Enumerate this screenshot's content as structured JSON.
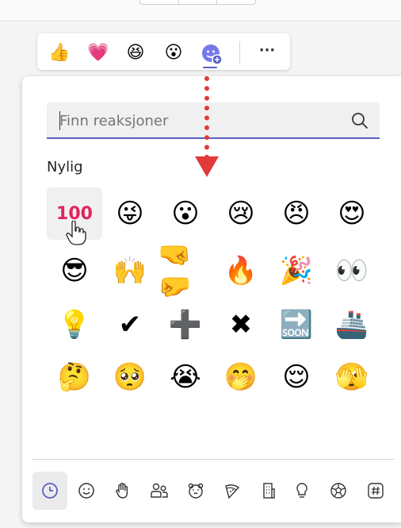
{
  "reaction_bar": {
    "items": [
      {
        "name": "like",
        "emoji": "👍"
      },
      {
        "name": "heart",
        "emoji": "💗"
      },
      {
        "name": "laugh",
        "emoji": "😆"
      },
      {
        "name": "surprised",
        "emoji": "😮"
      }
    ],
    "add_reaction_icon": "emoji-add-icon",
    "more_label": "···"
  },
  "search": {
    "placeholder": "Finn reaksjoner",
    "value": ""
  },
  "recent": {
    "heading": "Nylig",
    "rows": [
      [
        "100",
        "😜",
        "😮",
        "😢",
        "😠",
        "😍"
      ],
      [
        "😎",
        "🙌",
        "🤜🤛",
        "🔥",
        "🎉",
        "👀"
      ],
      [
        "💡",
        "✔",
        "➕",
        "✖",
        "🔜",
        "🚢"
      ],
      [
        "🤔",
        "🥺",
        "😭",
        "🤭",
        "😌",
        "🫣"
      ]
    ],
    "highlighted": "100"
  },
  "category_tabs": [
    {
      "name": "recent",
      "icon": "clock-icon",
      "selected": true
    },
    {
      "name": "smileys",
      "icon": "smiley-icon",
      "selected": false
    },
    {
      "name": "hands",
      "icon": "hand-icon",
      "selected": false
    },
    {
      "name": "people",
      "icon": "people-icon",
      "selected": false
    },
    {
      "name": "animals",
      "icon": "bear-icon",
      "selected": false
    },
    {
      "name": "food",
      "icon": "pizza-icon",
      "selected": false
    },
    {
      "name": "places",
      "icon": "building-icon",
      "selected": false
    },
    {
      "name": "objects",
      "icon": "lightbulb-icon",
      "selected": false
    },
    {
      "name": "activities",
      "icon": "soccer-icon",
      "selected": false
    },
    {
      "name": "symbols",
      "icon": "hashtag-icon",
      "selected": false
    }
  ],
  "colors": {
    "accent": "#5b5fc7",
    "annotation_arrow": "#e03a3a"
  }
}
